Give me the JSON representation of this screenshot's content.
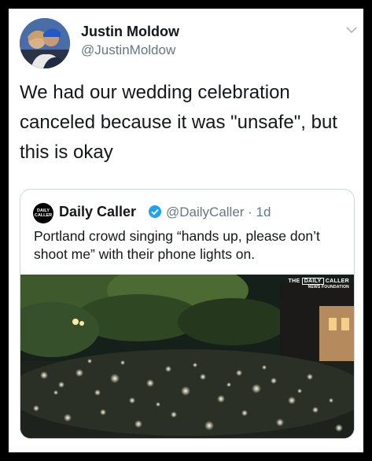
{
  "tweet": {
    "author_name": "Justin Moldow",
    "author_handle": "@JustinMoldow",
    "text": "We had our wedding celebration canceled because it was \"unsafe\", but this is okay"
  },
  "quoted_tweet": {
    "logo_line1": "DAILY",
    "logo_line2": "CALLER",
    "author_name": "Daily Caller",
    "author_handle": "@DailyCaller · 1d",
    "text": "Portland crowd singing “hands up, please don’t shoot me” with their phone lights on.",
    "media_watermark_the": "THE",
    "media_watermark_daily": "DAILY",
    "media_watermark_caller": "CALLER",
    "media_watermark_sub": "NEWS FOUNDATION"
  },
  "colors": {
    "text_primary": "#14171a",
    "text_secondary": "#657786",
    "verified_blue": "#1da1f2",
    "border": "#ccd6dd"
  },
  "icons": {
    "menu": "chevron-down-icon",
    "verified": "verified-badge-icon"
  }
}
